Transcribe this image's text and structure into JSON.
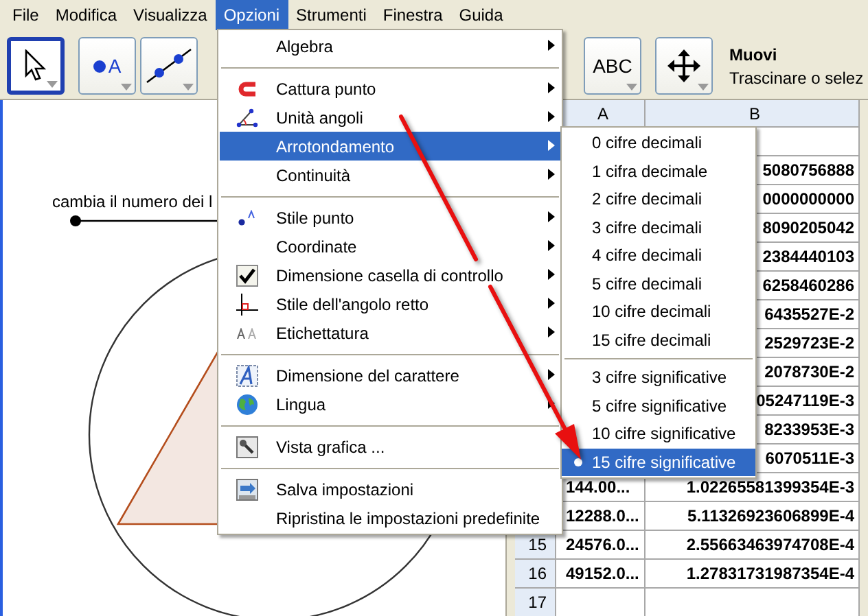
{
  "menubar": [
    {
      "label": "File",
      "selected": false
    },
    {
      "label": "Modifica",
      "selected": false
    },
    {
      "label": "Visualizza",
      "selected": false
    },
    {
      "label": "Opzioni",
      "selected": true
    },
    {
      "label": "Strumenti",
      "selected": false
    },
    {
      "label": "Finestra",
      "selected": false
    },
    {
      "label": "Guida",
      "selected": false
    }
  ],
  "toolbar": {
    "tools": [
      {
        "kind": "select",
        "selected": true
      },
      {
        "kind": "point",
        "label": "A",
        "selected": false
      },
      {
        "kind": "line",
        "selected": false
      },
      {
        "kind": "text",
        "label": "ABC",
        "selected": false
      },
      {
        "kind": "move",
        "selected": false
      }
    ],
    "info": {
      "title": "Muovi",
      "text": "Trascinare o selez"
    }
  },
  "graphics": {
    "slider_caption": "cambia il numero dei l",
    "slider": {
      "level": 0
    }
  },
  "spreadsheet": {
    "columns": [
      "A",
      "B"
    ],
    "rows": [
      {},
      {
        "b": "5080756888"
      },
      {
        "b": "0000000000"
      },
      {
        "b": "8090205042"
      },
      {
        "b": "2384440103"
      },
      {
        "b": "6258460286"
      },
      {
        "b": "6435527E-2"
      },
      {
        "b": "2529723E-2"
      },
      {
        "b": "2078730E-2"
      },
      {
        "b": "05247119E-3"
      },
      {
        "b": "8233953E-3"
      },
      {
        "b": "6070511E-3"
      },
      {
        "a": "144.00...",
        "b": "1.02265581399354E-3"
      },
      {
        "a": "12288.0...",
        "b": "5.11326923606899E-4"
      },
      {
        "number": "15",
        "a": "24576.0...",
        "b": "2.55663463974708E-4"
      },
      {
        "number": "16",
        "a": "49152.0...",
        "b": "1.27831731987354E-4"
      },
      {
        "number": "17"
      }
    ]
  },
  "options_menu": {
    "items": [
      {
        "kind": "item",
        "label": "Algebra",
        "submenu": true,
        "highlighted": false
      },
      {
        "kind": "separator"
      },
      {
        "kind": "item",
        "label": "Cattura punto",
        "submenu": true,
        "highlighted": false
      },
      {
        "kind": "item",
        "label": "Unità angoli",
        "submenu": true,
        "highlighted": false
      },
      {
        "kind": "item",
        "label": "Arrotondamento",
        "submenu": true,
        "highlighted": true
      },
      {
        "kind": "item",
        "label": "Continuità",
        "submenu": true,
        "highlighted": false
      },
      {
        "kind": "separator"
      },
      {
        "kind": "item",
        "label": "Stile punto",
        "submenu": true,
        "highlighted": false
      },
      {
        "kind": "item",
        "label": "Coordinate",
        "submenu": true,
        "highlighted": false
      },
      {
        "kind": "item",
        "label": "Dimensione casella di controllo",
        "submenu": true,
        "highlighted": false
      },
      {
        "kind": "item",
        "label": "Stile dell'angolo retto",
        "submenu": true,
        "highlighted": false
      },
      {
        "kind": "item",
        "label": "Etichettatura",
        "submenu": true,
        "highlighted": false
      },
      {
        "kind": "separator"
      },
      {
        "kind": "item",
        "label": "Dimensione del carattere",
        "submenu": true,
        "highlighted": false
      },
      {
        "kind": "item",
        "label": "Lingua",
        "submenu": true,
        "highlighted": false
      },
      {
        "kind": "separator"
      },
      {
        "kind": "item",
        "label": "Vista grafica ...",
        "submenu": false,
        "highlighted": false
      },
      {
        "kind": "separator"
      },
      {
        "kind": "item",
        "label": "Salva impostazioni",
        "submenu": false,
        "highlighted": false
      },
      {
        "kind": "item",
        "label": "Ripristina le impostazioni predefinite",
        "submenu": false,
        "highlighted": false
      }
    ]
  },
  "rounding_submenu": {
    "items": [
      {
        "kind": "item",
        "label": "0 cifre decimali",
        "selected": false,
        "highlighted": false
      },
      {
        "kind": "item",
        "label": "1 cifra decimale",
        "selected": false,
        "highlighted": false
      },
      {
        "kind": "item",
        "label": "2 cifre decimali",
        "selected": false,
        "highlighted": false
      },
      {
        "kind": "item",
        "label": "3 cifre decimali",
        "selected": false,
        "highlighted": false
      },
      {
        "kind": "item",
        "label": "4 cifre decimali",
        "selected": false,
        "highlighted": false
      },
      {
        "kind": "item",
        "label": "5 cifre decimali",
        "selected": false,
        "highlighted": false
      },
      {
        "kind": "item",
        "label": "10 cifre decimali",
        "selected": false,
        "highlighted": false
      },
      {
        "kind": "item",
        "label": "15 cifre decimali",
        "selected": false,
        "highlighted": false
      },
      {
        "kind": "separator"
      },
      {
        "kind": "item",
        "label": "3 cifre significative",
        "selected": false,
        "highlighted": false
      },
      {
        "kind": "item",
        "label": "5 cifre significative",
        "selected": false,
        "highlighted": false
      },
      {
        "kind": "item",
        "label": "10 cifre significative",
        "selected": false,
        "highlighted": false
      },
      {
        "kind": "item",
        "label": "15 cifre significative",
        "selected": true,
        "highlighted": true
      }
    ]
  }
}
